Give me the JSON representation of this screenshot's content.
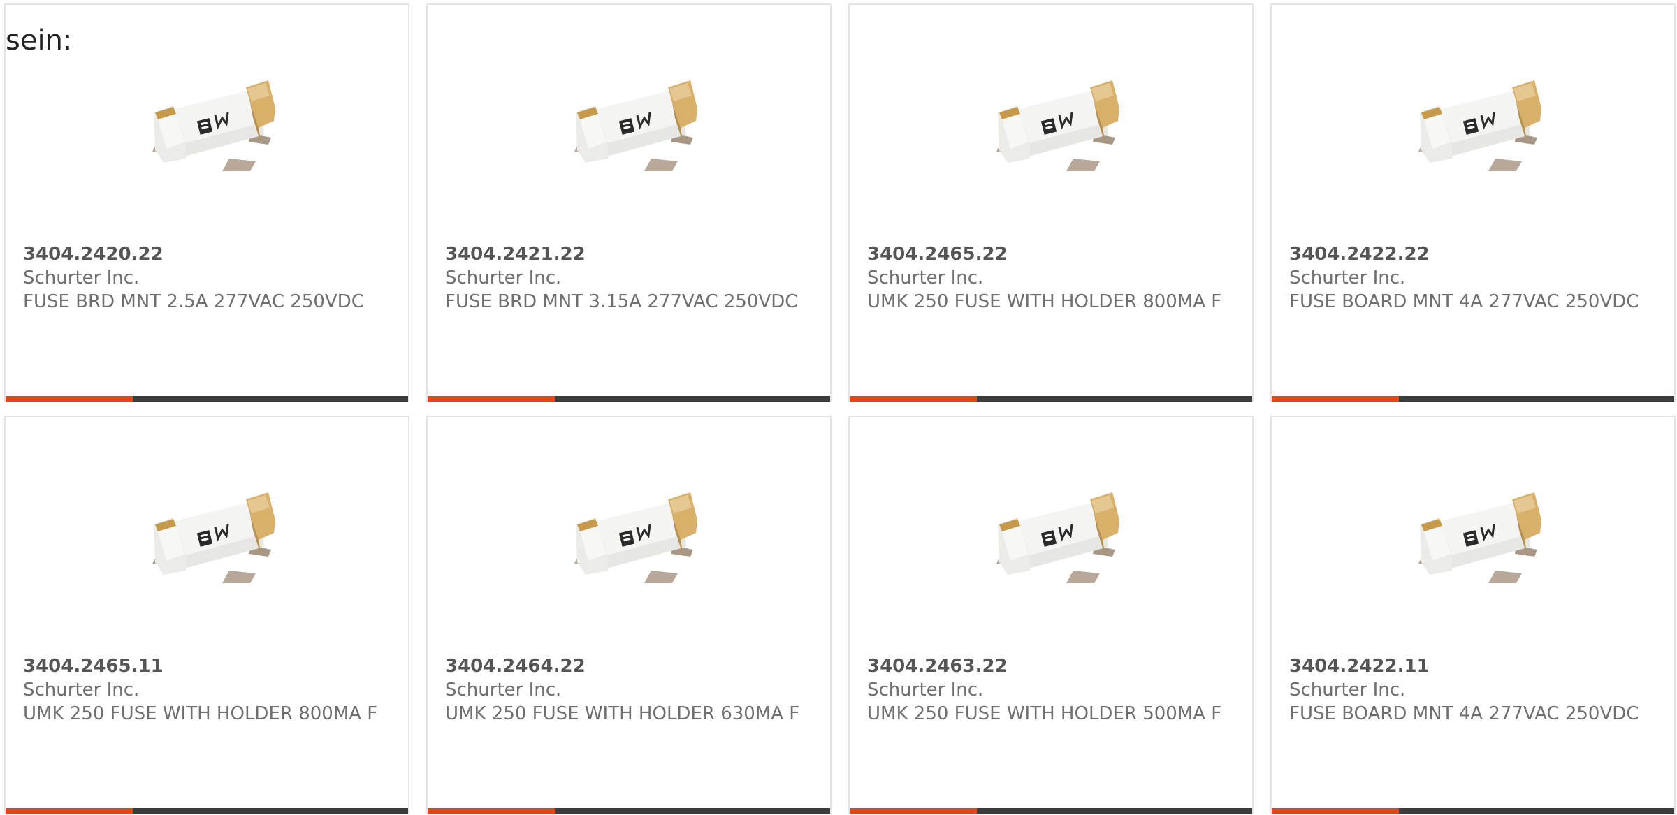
{
  "intro_text": "sein:",
  "colors": {
    "accent": "#e8431b",
    "bar": "#3c3c3c",
    "border": "#e4e4e4",
    "text": "#6f6f6f"
  },
  "products": [
    {
      "part_number": "3404.2420.22",
      "manufacturer": "Schurter Inc.",
      "description": "FUSE BRD MNT 2.5A 277VAC 250VDC",
      "image_icon": "smd-fuse-image"
    },
    {
      "part_number": "3404.2421.22",
      "manufacturer": "Schurter Inc.",
      "description": "FUSE BRD MNT 3.15A 277VAC 250VDC",
      "image_icon": "smd-fuse-image"
    },
    {
      "part_number": "3404.2465.22",
      "manufacturer": "Schurter Inc.",
      "description": "UMK 250 FUSE WITH HOLDER 800MA F",
      "image_icon": "smd-fuse-image"
    },
    {
      "part_number": "3404.2422.22",
      "manufacturer": "Schurter Inc.",
      "description": "FUSE BOARD MNT 4A 277VAC 250VDC",
      "image_icon": "smd-fuse-image"
    },
    {
      "part_number": "3404.2465.11",
      "manufacturer": "Schurter Inc.",
      "description": "UMK 250 FUSE WITH HOLDER 800MA F",
      "image_icon": "smd-fuse-image"
    },
    {
      "part_number": "3404.2464.22",
      "manufacturer": "Schurter Inc.",
      "description": "UMK 250 FUSE WITH HOLDER 630MA F",
      "image_icon": "smd-fuse-image"
    },
    {
      "part_number": "3404.2463.22",
      "manufacturer": "Schurter Inc.",
      "description": "UMK 250 FUSE WITH HOLDER 500MA F",
      "image_icon": "smd-fuse-image"
    },
    {
      "part_number": "3404.2422.11",
      "manufacturer": "Schurter Inc.",
      "description": "FUSE BOARD MNT 4A 277VAC 250VDC",
      "image_icon": "smd-fuse-image"
    }
  ]
}
